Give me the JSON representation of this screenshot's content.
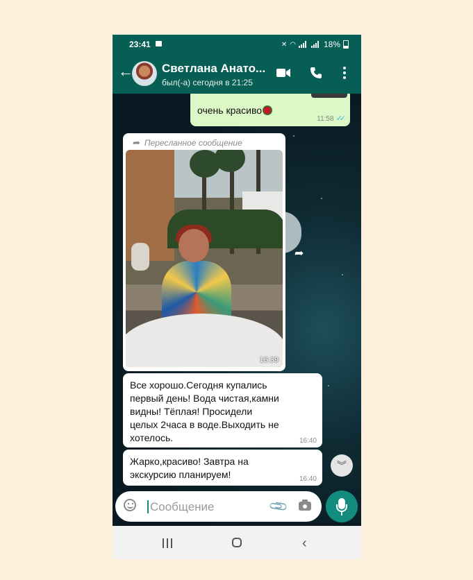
{
  "status_bar": {
    "time": "23:41",
    "battery": "18%"
  },
  "header": {
    "back_icon": "arrow-left",
    "contact_name": "Светлана Анато...",
    "last_seen": "был(-а) сегодня в 21:25",
    "actions": [
      "video-call-icon",
      "voice-call-icon",
      "more-options-icon"
    ]
  },
  "messages": [
    {
      "direction": "outgoing",
      "text": "очень красиво",
      "emoji": "rose",
      "time": "11:58",
      "status": "read"
    },
    {
      "direction": "incoming",
      "type": "image",
      "forwarded_label": "Пересланное сообщение",
      "time": "16:39"
    },
    {
      "direction": "incoming",
      "lines": [
        "Все хорошо.Сегодня купались",
        "первый день! Вода чистая,камни",
        "видны! Тёплая! Просидели",
        "целых 2часа в воде.Выходить не",
        "хотелось."
      ],
      "time": "16:40"
    },
    {
      "direction": "incoming",
      "lines": [
        "Жарко,красиво! Завтра на",
        "экскурсию планируем!"
      ],
      "time": "16:40"
    }
  ],
  "composer": {
    "placeholder": "Сообщение",
    "value": ""
  },
  "colors": {
    "header": "#075e54",
    "accent": "#128c7e",
    "outgoing_bubble": "#dcf8c6",
    "incoming_bubble": "#ffffff",
    "read_ticks": "#34b7f1"
  }
}
